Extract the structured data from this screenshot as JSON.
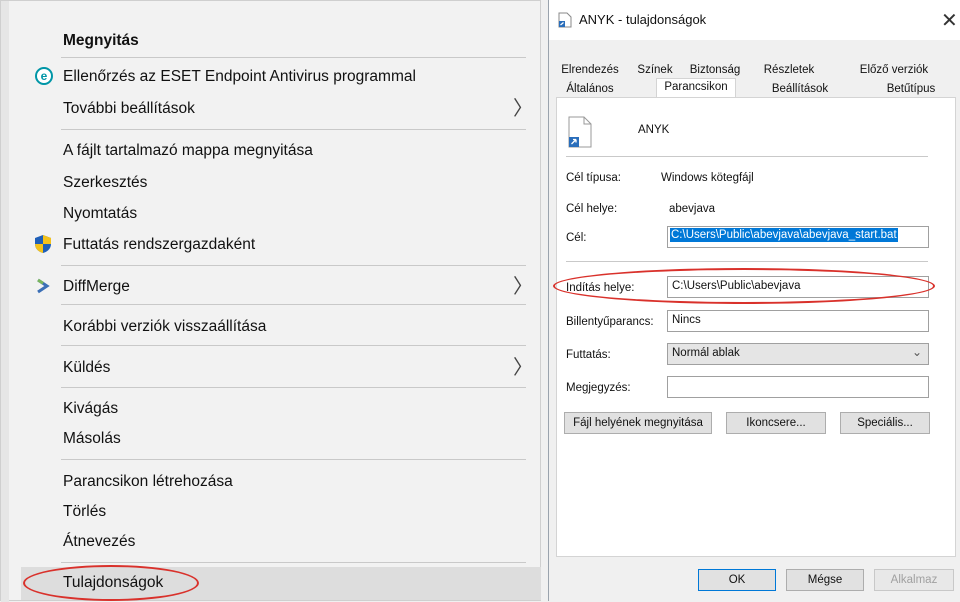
{
  "context_menu": {
    "items": {
      "open": "Megnyitás",
      "eset": "Ellenőrzés az ESET Endpoint Antivirus programmal",
      "more": "További beállítások",
      "open_location": "A fájlt tartalmazó mappa megnyitása",
      "edit": "Szerkesztés",
      "print": "Nyomtatás",
      "run_admin": "Futtatás rendszergazdaként",
      "diffmerge": "DiffMerge",
      "restore": "Korábbi verziók visszaállítása",
      "send": "Küldés",
      "cut": "Kivágás",
      "copy": "Másolás",
      "shortcut": "Parancsikon létrehozása",
      "delete": "Törlés",
      "rename": "Átnevezés",
      "properties": "Tulajdonságok"
    },
    "submenu_chevron": "〉",
    "eset_icon_letter": "e"
  },
  "dialog": {
    "title": "ANYK - tulajdonságok",
    "close": "✕",
    "tabs_row1": [
      "Elrendezés",
      "Színek",
      "Biztonság",
      "Részletek",
      "Előző verziók"
    ],
    "tabs_row2": [
      "Általános",
      "Parancsikon",
      "Beállítások",
      "Betűtípus"
    ],
    "active_tab": "Parancsikon",
    "file_name": "ANYK",
    "target_type_label": "Cél típusa:",
    "target_type_value": "Windows kötegfájl",
    "target_location_label": "Cél helye:",
    "target_location_value": "abevjava",
    "target_label": "Cél:",
    "target_value": "C:\\Users\\Public\\abevjava\\abevjava_start.bat",
    "start_in_label": "Indítás helye:",
    "start_in_value": "C:\\Users\\Public\\abevjava",
    "shortcut_key_label": "Billentyűparancs:",
    "shortcut_key_value": "Nincs",
    "run_label": "Futtatás:",
    "run_value": "Normál ablak",
    "comment_label": "Megjegyzés:",
    "comment_value": "",
    "btn_open_location": "Fájl helyének megnyitása",
    "btn_change_icon": "Ikoncsere...",
    "btn_advanced": "Speciális...",
    "btn_ok": "OK",
    "btn_cancel": "Mégse",
    "btn_apply": "Alkalmaz"
  },
  "colors": {
    "highlight_oval": "#d9312b",
    "selection": "#0078d7",
    "eset_accent": "#0096a7",
    "shield_blue": "#1f5fb8",
    "shield_yellow": "#f4c21b"
  }
}
